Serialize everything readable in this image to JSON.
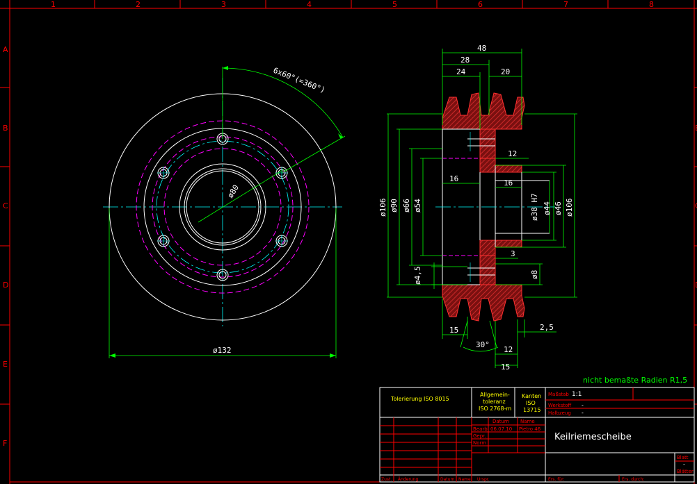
{
  "colors": {
    "frame": "#ff0000",
    "white": "#ffffff",
    "magenta": "#ff00ff",
    "cyan": "#00ffff",
    "green": "#00ff00",
    "yellow": "#ffff00",
    "hatch": "#c02020"
  },
  "grid": {
    "columns": [
      "1",
      "2",
      "3",
      "4",
      "5",
      "6",
      "7",
      "8"
    ],
    "rows": [
      "A",
      "B",
      "C",
      "D",
      "E",
      "F"
    ]
  },
  "front_view": {
    "angle_note": "6x60°(=360°)",
    "bore_label": "ø80",
    "outer_dia_label": "ø132"
  },
  "section_view": {
    "dim_48": "48",
    "dim_28": "28",
    "dim_24": "24",
    "dim_20": "20",
    "dim_12_top": "12",
    "dim_16_left": "16",
    "dim_16_right": "16",
    "dim_3": "3",
    "dim_15_left": "15",
    "dim_2_5": "2,5",
    "dim_30deg": "30°",
    "dim_12_bottom": "12",
    "dim_15_bottom": "15",
    "dia_106_left": "ø106",
    "dia_90": "ø90",
    "dia_66": "ø66",
    "dia_54": "ø54",
    "dia_4_5": "ø4,5",
    "dia_38": "ø38 H7",
    "dia_44": "ø44",
    "dia_46": "ø46",
    "dia_106_right": "ø106",
    "dia_8": "ø8"
  },
  "note": "nicht bemaßte Radien R1,5",
  "title_block": {
    "tolerancing": "Tolerierung ISO 8015",
    "general_tol_1": "Allgemein-",
    "general_tol_2": "toleranz",
    "general_tol_3": "ISO 2768-m",
    "edges_1": "Kanten",
    "edges_2": "ISO",
    "edges_3": "13715",
    "scale_label": "Maßstab",
    "scale_value": "1:1",
    "material_label": "Werkstoff",
    "material_value": "-",
    "semi_label": "Halbzeug",
    "semi_value": "-",
    "date_header": "Datum",
    "name_header": "Name",
    "drawn_label": "Bearb.",
    "drawn_date": "06.07.10",
    "drawn_name": "Pietro 46",
    "checked_label": "Gepr.",
    "norm_label": "Norm",
    "title": "Keilriemescheibe",
    "sheet_label": "Blatt",
    "sheet_value": "-",
    "sheets_label": "Blätter",
    "rev_zust": "Zust.",
    "rev_change": "Änderung",
    "rev_date": "Datum",
    "rev_name": "Name",
    "origin": "Urspr.",
    "replacement_for": "Ers. für:",
    "replaced_by": "Ers. durch:"
  }
}
